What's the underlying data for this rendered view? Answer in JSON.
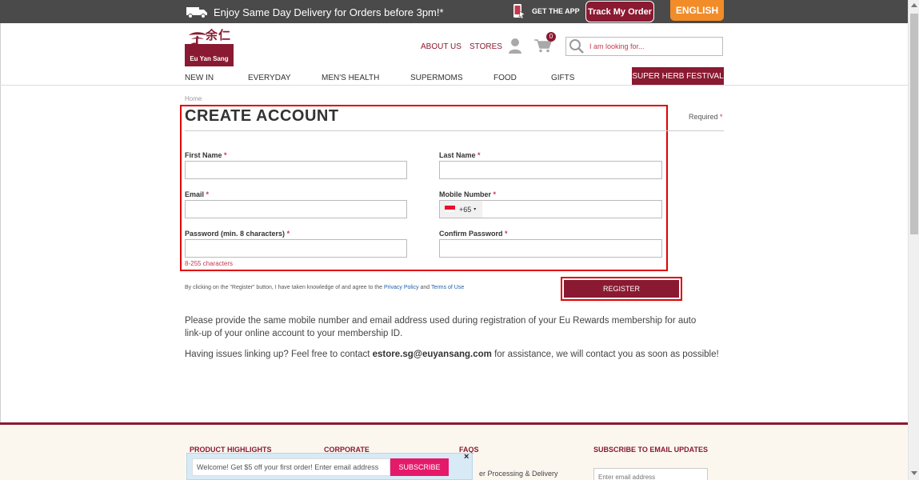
{
  "topbar": {
    "delivery_text": "Enjoy Same Day Delivery for Orders before 3pm!*",
    "get_app": "GET THE APP",
    "track_order": "Track My Order",
    "language": "ENGLISH"
  },
  "header": {
    "logo_text": "Eu Yan Sang",
    "logo_cn": "余仁生",
    "about": "ABOUT US",
    "stores": "STORES",
    "cart_count": "0",
    "search_placeholder": "I am looking for..."
  },
  "nav": {
    "items": [
      "NEW IN",
      "EVERYDAY",
      "MEN'S HEALTH",
      "SUPERMOMS",
      "FOOD",
      "GIFTS"
    ],
    "featured": "SUPER HERB FESTIVAL"
  },
  "page": {
    "breadcrumb": "Home",
    "title": "CREATE ACCOUNT",
    "required": "Required",
    "star": "*"
  },
  "form": {
    "first_name": "First Name",
    "last_name": "Last Name",
    "email": "Email",
    "mobile": "Mobile Number",
    "country_code": "+65",
    "password": "Password (min. 8 characters)",
    "confirm_password": "Confirm Password",
    "password_hint": "8-255 characters"
  },
  "consent": {
    "text": "By clicking on the \"Register\" button, I have taken knowledge of and agree to the",
    "privacy": "Privacy Policy",
    "and": "and",
    "terms": "Terms of Use"
  },
  "register_label": "REGISTER",
  "info": {
    "p1": "Please provide the same mobile number and email address used during registration of your Eu Rewards membership for auto link-up of your online account to your membership ID.",
    "p2_before": "Having issues linking up? Feel free to contact ",
    "p2_email": "estore.sg@euyansang.com",
    "p2_after": " for assistance, we will contact you as soon as possible!"
  },
  "footer": {
    "col1": "PRODUCT HIGHLIGHTS",
    "col2": "CORPORATE",
    "col3": "FAQS",
    "col4": "SUBSCRIBE TO EMAIL UPDATES",
    "faq_item": "er Processing & Delivery",
    "email_placeholder": "Enter email address"
  },
  "popup": {
    "text": "Welcome! Get $5 off your first order! Enter email address",
    "button": "SUBSCRIBE",
    "close": "×"
  },
  "colors": {
    "brand": "#8a1a31",
    "accent": "#f28c28",
    "highlight": "#e00000",
    "popup_button": "#e5196a"
  }
}
